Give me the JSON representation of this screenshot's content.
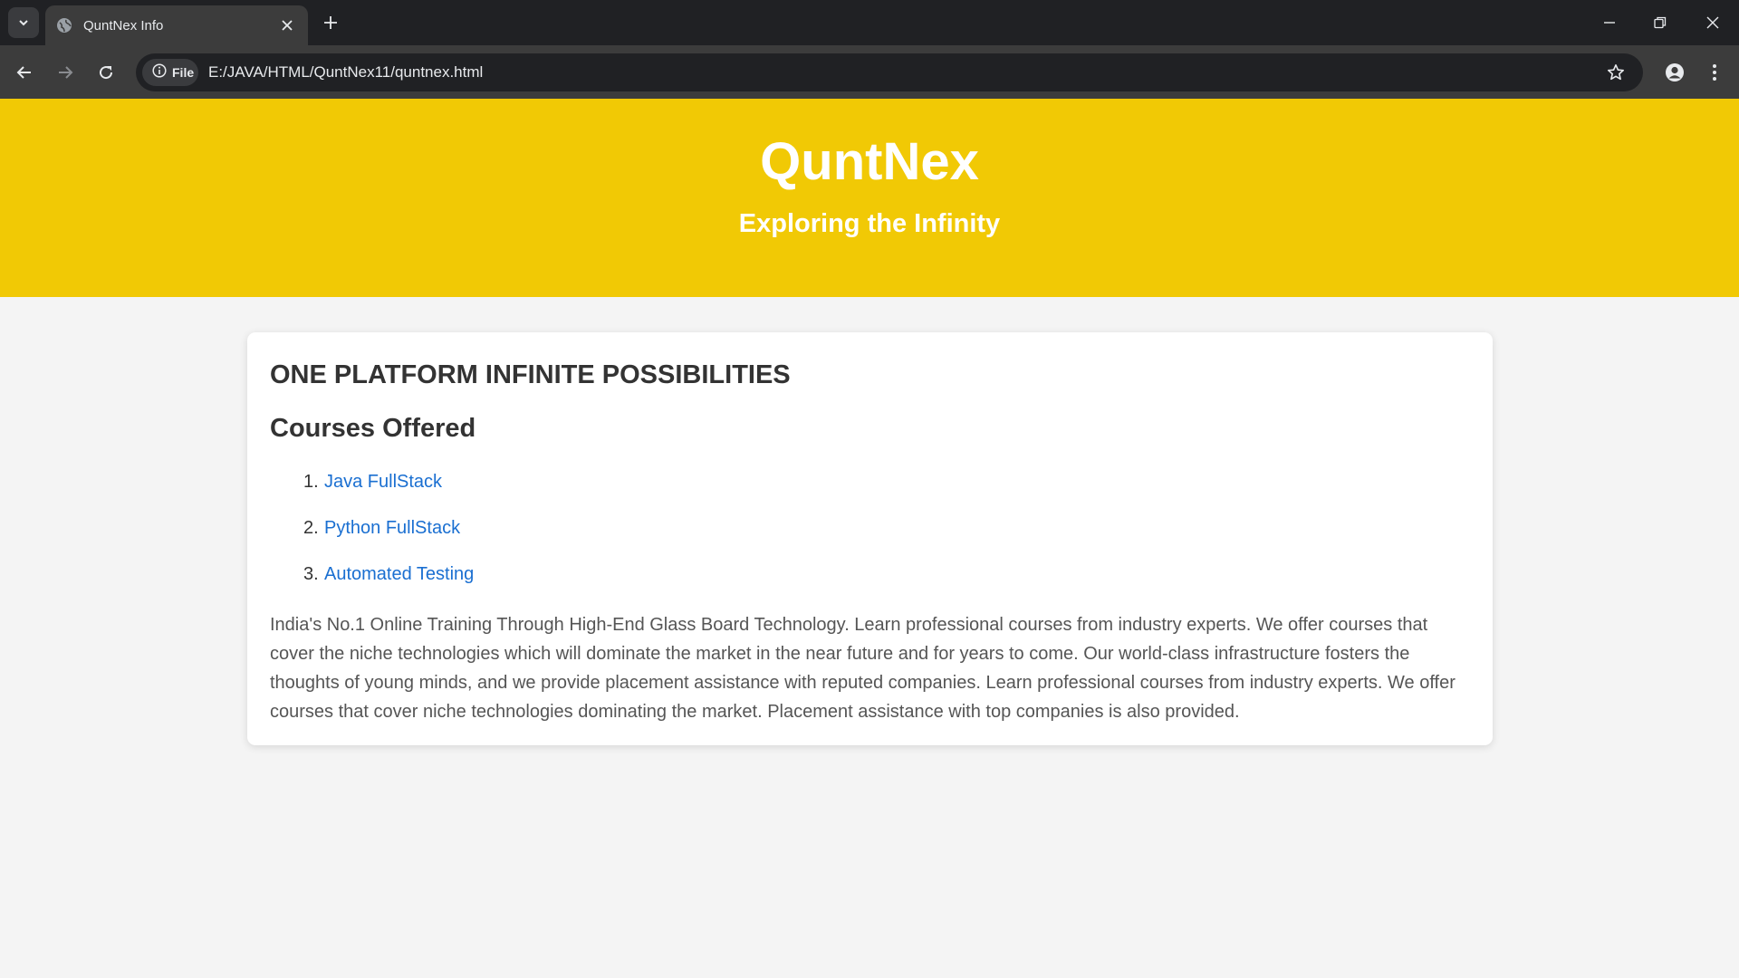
{
  "browser": {
    "tab": {
      "title": "QuntNex Info"
    },
    "address_bar": {
      "chip_label": "File",
      "url": "E:/JAVA/HTML/QuntNex11/quntnex.html"
    }
  },
  "header": {
    "title": "QuntNex",
    "tagline": "Exploring the Infinity"
  },
  "content": {
    "heading": "ONE PLATFORM INFINITE POSSIBILITIES",
    "courses_heading": "Courses Offered",
    "courses": [
      {
        "number": "1.",
        "label": "Java FullStack"
      },
      {
        "number": "2.",
        "label": "Python FullStack"
      },
      {
        "number": "3.",
        "label": "Automated Testing"
      }
    ],
    "description": "India's No.1 Online Training Through High-End Glass Board Technology. Learn professional courses from industry experts. We offer courses that cover the niche technologies which will dominate the market in the near future and for years to come. Our world-class infrastructure fosters the thoughts of young minds, and we provide placement assistance with reputed companies. Learn professional courses from industry experts. We offer courses that cover niche technologies dominating the market. Placement assistance with top companies is also provided."
  },
  "colors": {
    "header_bg": "#f1c905",
    "link": "#1a6fd1",
    "page_bg": "#f4f4f4",
    "chrome_dark": "#202124",
    "chrome_toolbar": "#3c3c3c"
  },
  "icons": [
    "tab-search-icon",
    "globe-icon",
    "close-icon",
    "plus-icon",
    "minimize-icon",
    "restore-icon",
    "back-arrow-icon",
    "forward-arrow-icon",
    "reload-icon",
    "info-icon",
    "star-icon",
    "profile-icon",
    "kebab-menu-icon"
  ]
}
